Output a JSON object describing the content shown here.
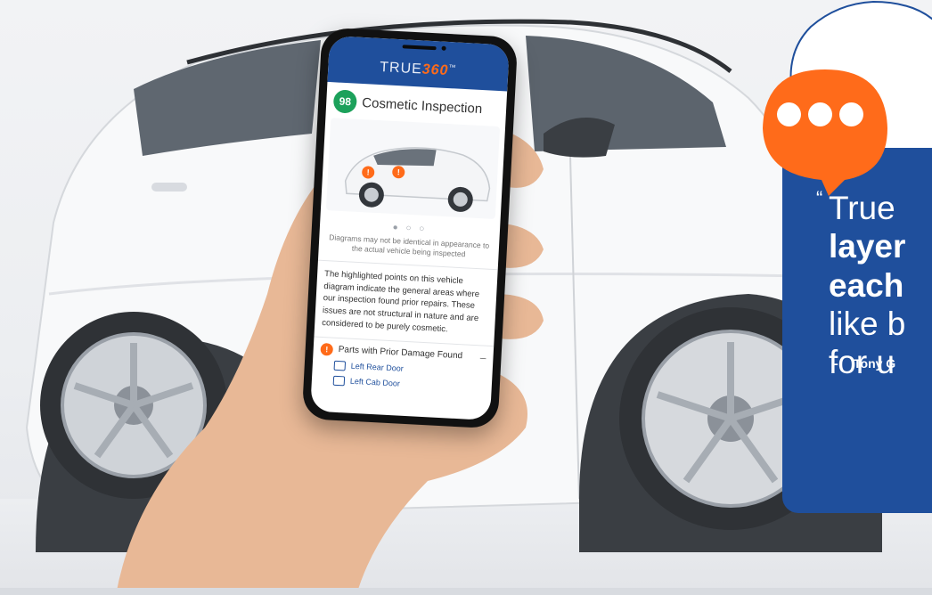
{
  "phone": {
    "brand_prefix": "TRUE",
    "brand_accent": "360",
    "brand_tm": "™",
    "score": "98",
    "inspection_title": "Cosmetic Inspection",
    "carousel_dots": "● ○ ○",
    "disclaimer": "Diagrams may not be identical in appearance to the actual vehicle being inspected",
    "summary": "The highlighted points on this vehicle diagram indicate the general areas where our inspection found prior repairs. These issues are not structural in nature and are considered to be purely cosmetic.",
    "parts_title": "Parts with Prior Damage Found",
    "parts_toggle": "–",
    "parts": [
      {
        "label": "Left Rear Door"
      },
      {
        "label": "Left Cab Door"
      }
    ],
    "warning_glyph": "!"
  },
  "quote": {
    "open_mark": "“",
    "line1": "True",
    "line2": "layer",
    "line3": "each",
    "line4": "like b",
    "line5": "for u",
    "dash": "-",
    "author": "Tony G"
  },
  "colors": {
    "brand_blue": "#1f4f9c",
    "accent_orange": "#ff6b1a",
    "score_green": "#1ca15b"
  }
}
